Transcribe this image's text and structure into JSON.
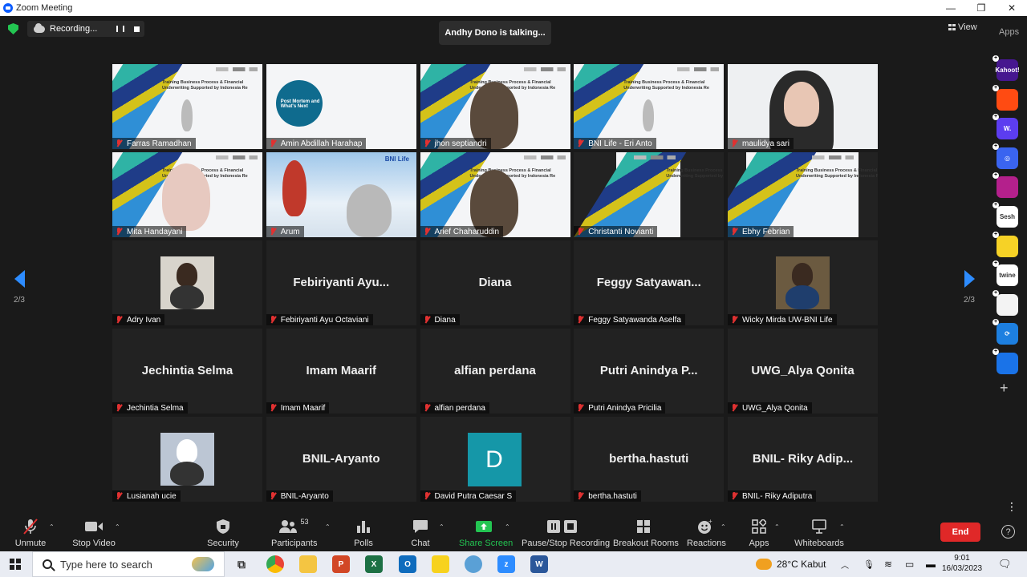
{
  "window": {
    "title": "Zoom Meeting",
    "min": "—",
    "max": "❐",
    "close": "✕"
  },
  "recording": {
    "label": "Recording..."
  },
  "talking": "Andhy Dono is talking...",
  "view": {
    "label": "View"
  },
  "apps_panel": {
    "label": "Apps",
    "items": [
      {
        "name": "kahoot-app-icon",
        "text": "Kahoot!",
        "color": "#46178f"
      },
      {
        "name": "red-app-icon",
        "text": "",
        "color": "#ff4b12"
      },
      {
        "name": "wooclap-app-icon",
        "text": "W.",
        "color": "#5c3df0"
      },
      {
        "name": "blue-ring-app-icon",
        "text": "◎",
        "color": "#3a64f0"
      },
      {
        "name": "purple-app-icon",
        "text": "",
        "color": "#b4208c"
      },
      {
        "name": "sesh-app-icon",
        "text": "Sesh",
        "color": "#ffffff"
      },
      {
        "name": "yellow-app-icon",
        "text": "",
        "color": "#f6d226"
      },
      {
        "name": "twine-app-icon",
        "text": "twine",
        "color": "#ffffff"
      },
      {
        "name": "grid-app-icon",
        "text": "",
        "color": "#f3f3f3"
      },
      {
        "name": "sync-app-icon",
        "text": "⟳",
        "color": "#1d7fe0"
      },
      {
        "name": "stack-app-icon",
        "text": "",
        "color": "#1a73e8"
      }
    ]
  },
  "pager": {
    "left": "2/3",
    "right": "2/3"
  },
  "participants": [
    {
      "name": "Farras Ramadhan",
      "kind": "slide"
    },
    {
      "name": "Amin Abdillah Harahap",
      "kind": "slide2"
    },
    {
      "name": "jhon septiandri",
      "kind": "slidecam"
    },
    {
      "name": "BNI Life - Eri Anto",
      "kind": "slide"
    },
    {
      "name": "maulidya sari",
      "kind": "cam"
    },
    {
      "name": "Mita Handayani",
      "kind": "slidecam"
    },
    {
      "name": "Arum",
      "kind": "photo"
    },
    {
      "name": "Arief Chaharuddin",
      "kind": "slidecam"
    },
    {
      "name": "Christanti Novianti",
      "kind": "narrowslide"
    },
    {
      "name": "Ebhy Febrian",
      "kind": "midslide"
    },
    {
      "name": "Adry Ivan",
      "kind": "thumb",
      "big": ""
    },
    {
      "name": "Febiriyanti Ayu Octaviani",
      "kind": "text",
      "big": "Febiriyanti  Ayu..."
    },
    {
      "name": "Diana",
      "kind": "text",
      "big": "Diana"
    },
    {
      "name": "Feggy Satyawanda Aselfa",
      "kind": "text",
      "big": "Feggy  Satyawan..."
    },
    {
      "name": "Wicky Mirda UW-BNI Life",
      "kind": "thumb",
      "big": ""
    },
    {
      "name": "Jechintia Selma",
      "kind": "text",
      "big": "Jechintia Selma"
    },
    {
      "name": "Imam Maarif",
      "kind": "text",
      "big": "Imam Maarif"
    },
    {
      "name": "alfian perdana",
      "kind": "text",
      "big": "alfian perdana"
    },
    {
      "name": "Putri Anindya Pricilia",
      "kind": "text",
      "big": "Putri Anindya P..."
    },
    {
      "name": "UWG_Alya Qonita",
      "kind": "text",
      "big": "UWG_Alya Qonita"
    },
    {
      "name": "Lusianah ucie",
      "kind": "thumb",
      "big": ""
    },
    {
      "name": "BNIL-Aryanto",
      "kind": "text",
      "big": "BNIL-Aryanto"
    },
    {
      "name": "David Putra Caesar S",
      "kind": "avatar",
      "big": "D"
    },
    {
      "name": "bertha.hastuti",
      "kind": "text",
      "big": "bertha.hastuti"
    },
    {
      "name": "BNIL- Riky Adiputra",
      "kind": "text",
      "big": "BNIL-  Riky Adip..."
    }
  ],
  "slide_text": "Training Business Process & Financial Underwriting Supported by Indonesia Re",
  "slide2_text": "Post Mortem and What's Next",
  "arum_overlay": "BNI Life",
  "toolbar": {
    "unmute": "Unmute",
    "stop_video": "Stop Video",
    "security": "Security",
    "participants": "Participants",
    "participants_count": "53",
    "polls": "Polls",
    "chat": "Chat",
    "share": "Share Screen",
    "record": "Pause/Stop Recording",
    "breakout": "Breakout Rooms",
    "reactions": "Reactions",
    "apps": "Apps",
    "whiteboards": "Whiteboards",
    "end": "End",
    "help": "?"
  },
  "taskbar": {
    "search_placeholder": "Type here to search",
    "weather": "28°C  Kabut",
    "time": "9:01",
    "date": "16/03/2023"
  }
}
